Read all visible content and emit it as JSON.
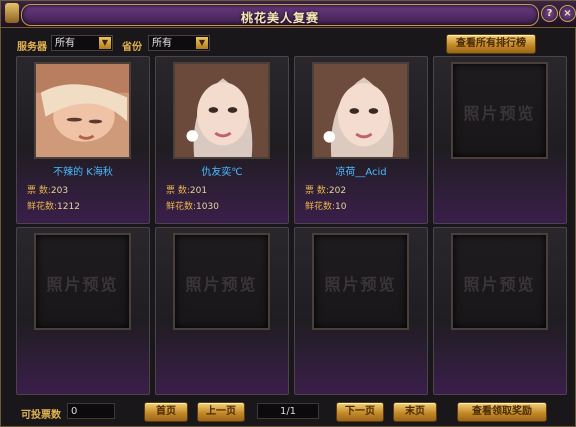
{
  "window": {
    "title": "桃花美人复赛",
    "help_label": "?",
    "close_label": "×"
  },
  "filters": {
    "server_label": "服务器",
    "server_value": "所有",
    "province_label": "省份",
    "province_value": "所有",
    "dropdown_arrow": "▼",
    "view_all_label": "查看所有排行榜"
  },
  "contestants": [
    {
      "name": "不辣的 K海秋",
      "votes_label": "票   数:",
      "votes": "203",
      "flowers_label": "鲜花数:",
      "flowers": "1212"
    },
    {
      "name": "仇友奕℃",
      "votes_label": "票   数:",
      "votes": "201",
      "flowers_label": "鲜花数:",
      "flowers": "1030"
    },
    {
      "name": "凉荷__Acid",
      "votes_label": "票   数:",
      "votes": "202",
      "flowers_label": "鲜花数:",
      "flowers": "10"
    }
  ],
  "placeholder_text": "照片预览",
  "footer": {
    "votes_available_label": "可投票数",
    "votes_available": "0",
    "first_page_label": "首页",
    "prev_page_label": "上一页",
    "page_indicator": "1/1",
    "next_page_label": "下一页",
    "last_page_label": "末页",
    "claim_reward_label": "查看领取奖励"
  },
  "colors": {
    "accent_gold": "#e0b250",
    "name_blue": "#4ab8ff",
    "title_purple": "#6a3c82"
  }
}
